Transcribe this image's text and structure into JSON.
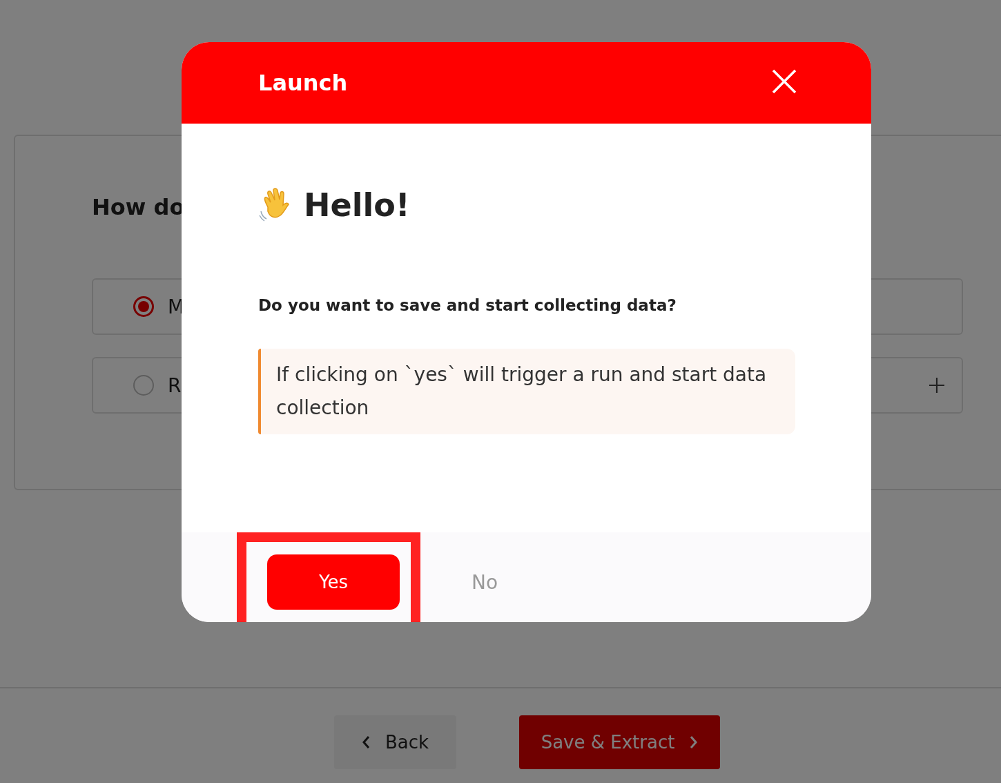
{
  "page": {
    "question": "How do",
    "options": [
      {
        "label": "M",
        "selected": true,
        "add_button": false
      },
      {
        "label": "R",
        "selected": false,
        "add_button": true
      }
    ],
    "back": "Back",
    "save": "Save & Extract"
  },
  "dialog": {
    "title": "Launch",
    "greeting": "Hello!",
    "question": "Do you want to save and start collecting data?",
    "note": "If clicking on `yes` will trigger a run and start data collection",
    "actions": [
      {
        "label": "Yes",
        "kind": "primary",
        "highlighted": true
      },
      {
        "label": "No",
        "kind": "secondary",
        "highlighted": false
      }
    ]
  }
}
